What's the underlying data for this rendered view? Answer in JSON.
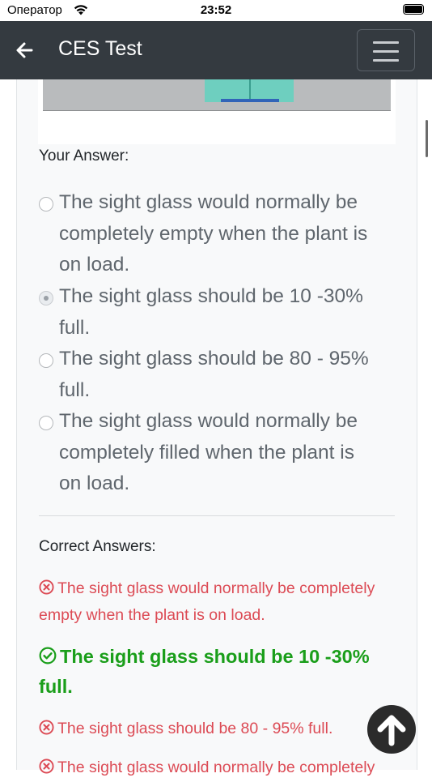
{
  "status_bar": {
    "carrier": "Оператор",
    "time": "23:52"
  },
  "navbar": {
    "title": "CES Test",
    "back_icon": "arrow-left-icon",
    "menu_icon": "hamburger-icon"
  },
  "question": {
    "your_answer_label": "Your Answer:",
    "options": [
      {
        "lines": [
          "The sight glass would normally be",
          "completely empty when the plant is",
          "on load."
        ],
        "selected": false
      },
      {
        "lines": [
          "The sight glass should be 10 -30%",
          "full."
        ],
        "selected": true
      },
      {
        "lines": [
          "The sight glass should be 80 - 95%",
          "full."
        ],
        "selected": false
      },
      {
        "lines": [
          "The sight glass would normally be",
          "completely filled when the plant is",
          "on load."
        ],
        "selected": false
      }
    ]
  },
  "correct_answers": {
    "label": "Correct Answers:",
    "items": [
      {
        "lines": [
          "The sight glass would normally be completely",
          "empty when the plant is on load."
        ],
        "correct": false
      },
      {
        "lines": [
          "The sight glass should be 10 -30%",
          "full."
        ],
        "correct": true
      },
      {
        "lines": [
          "The sight glass should be 80 - 95% full."
        ],
        "correct": false
      },
      {
        "lines": [
          "The sight glass would normally be completely"
        ],
        "correct": false
      }
    ]
  },
  "colors": {
    "navbar_bg": "#343a40",
    "wrong": "#dc4b55",
    "right": "#1a9e1a",
    "option_text": "#5f666d"
  },
  "icons": {
    "wrong": "x-circle-icon",
    "right": "check-circle-icon",
    "scroll_top": "arrow-up-circle-icon"
  }
}
